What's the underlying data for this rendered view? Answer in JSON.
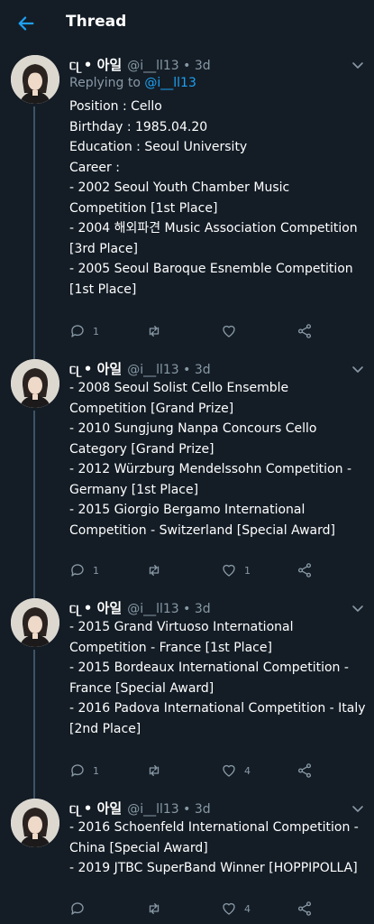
{
  "header": {
    "back_icon": "arrow-left-icon",
    "title": "Thread"
  },
  "colors": {
    "background": "#141d26",
    "accent": "#1da1f2",
    "muted": "#8899a6",
    "thread_line": "#3d5466"
  },
  "tweets": [
    {
      "name": "ᥴᥨ • 아일",
      "handle": "@i__ll13 • 3d",
      "reply_prefix": "Replying to",
      "reply_mention": "@i__ll13",
      "lines": [
        "Position : Cello",
        "Birthday : 1985.04.20",
        "Education : Seoul University",
        "Career :",
        "- 2002 Seoul Youth Chamber Music Competition [1st Place]",
        "- 2004 해외파견 Music Association Competition [3rd Place]",
        "- 2005 Seoul Baroque Esnemble Competition [1st Place]"
      ],
      "reply_count": "1",
      "retweet_count": "",
      "like_count": ""
    },
    {
      "name": "ᥴᥨ • 아일",
      "handle": "@i__ll13 • 3d",
      "lines": [
        "- 2008 Seoul Solist Cello Ensemble Competition [Grand Prize]",
        "- 2010 Sungjung Nanpa Concours Cello Category [Grand Prize]",
        "- 2012 Würzburg Mendelssohn Competition - Germany [1st Place]",
        "- 2015 Giorgio Bergamo International Competition - Switzerland [Special Award]"
      ],
      "reply_count": "1",
      "retweet_count": "",
      "like_count": "1"
    },
    {
      "name": "ᥴᥨ • 아일",
      "handle": "@i__ll13 • 3d",
      "lines": [
        "- 2015 Grand Virtuoso International Competition - France [1st Place]",
        "- 2015 Bordeaux International Competition - France [Special Award]",
        "- 2016 Padova International Competition - Italy [2nd Place]"
      ],
      "reply_count": "1",
      "retweet_count": "",
      "like_count": "4"
    },
    {
      "name": "ᥴᥨ • 아일",
      "handle": "@i__ll13 • 3d",
      "lines": [
        "- 2016 Schoenfeld International Competition - China [Special Award]",
        "- 2019 JTBC SuperBand Winner [HOPPIPOLLA]"
      ],
      "reply_count": "",
      "retweet_count": "",
      "like_count": "4"
    }
  ]
}
